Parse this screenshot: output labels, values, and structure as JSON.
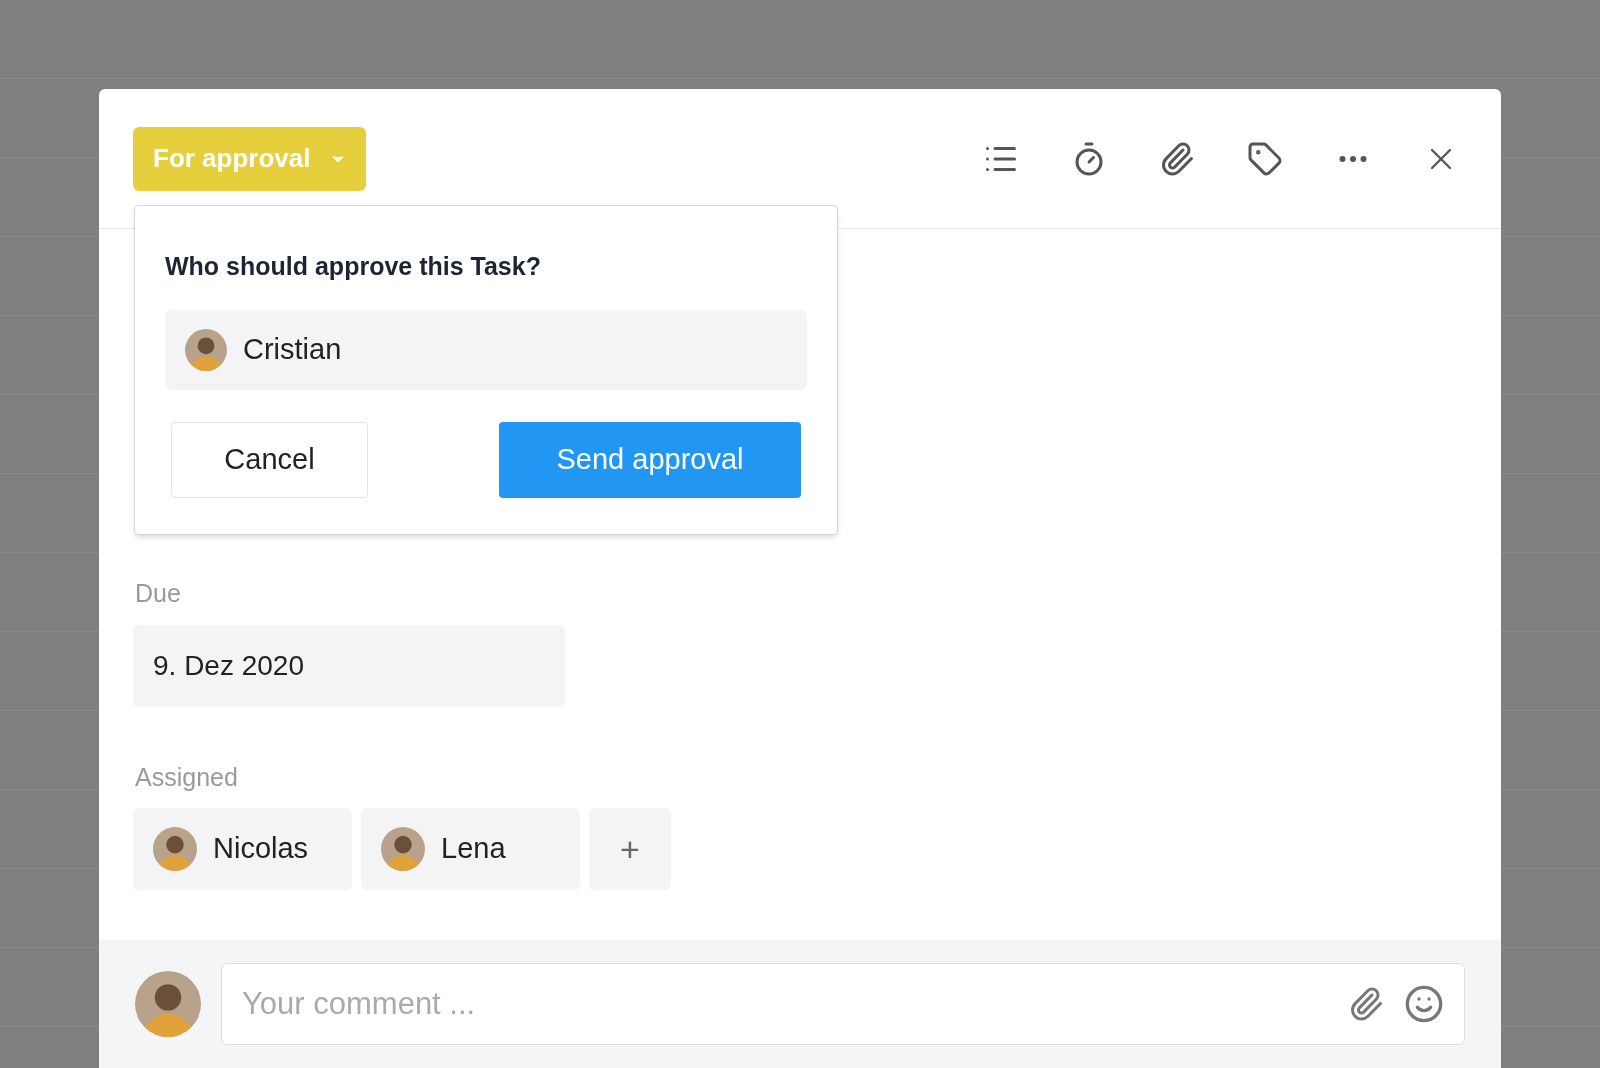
{
  "status_button": {
    "label": "For approval"
  },
  "approval_popover": {
    "question": "Who should approve this Task?",
    "approver": {
      "name": "Cristian"
    },
    "buttons": [
      {
        "label": "Cancel",
        "kind": "secondary"
      },
      {
        "label": "Send approval",
        "kind": "primary"
      }
    ]
  },
  "due": {
    "label": "Due",
    "value": "9. Dez 2020"
  },
  "assigned": {
    "label": "Assigned",
    "people": [
      {
        "name": "Nicolas"
      },
      {
        "name": "Lena"
      }
    ],
    "add_button": "+"
  },
  "comment": {
    "placeholder": "Your comment ..."
  }
}
